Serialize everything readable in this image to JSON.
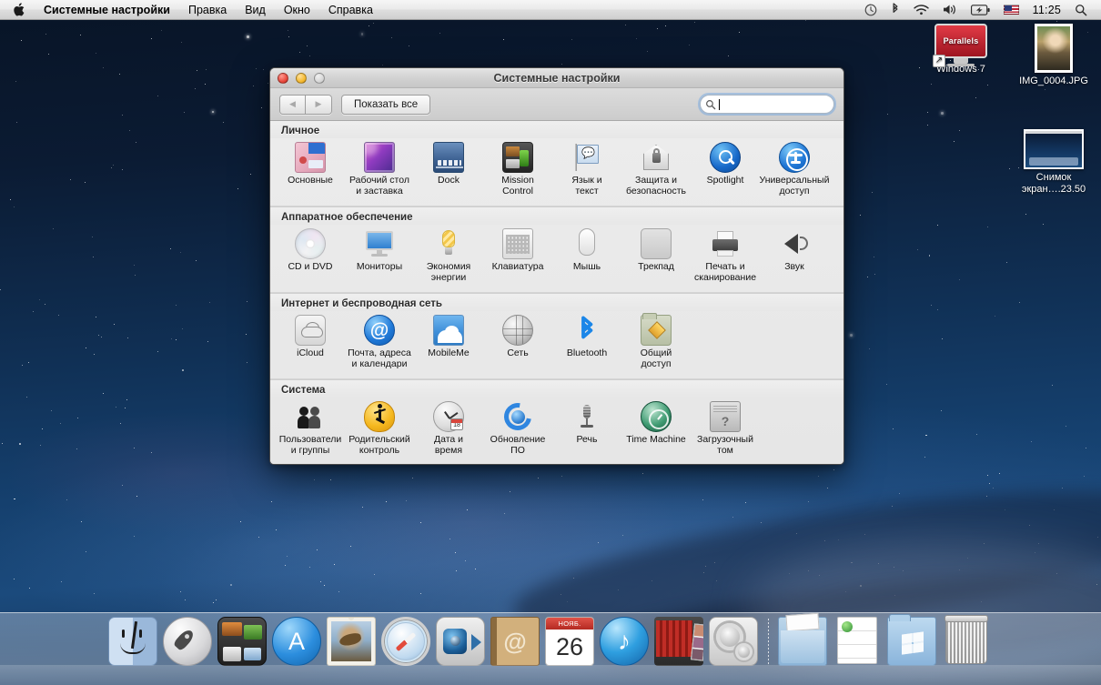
{
  "menubar": {
    "apple_icon": "apple-logo-icon",
    "items": [
      {
        "label": "Системные настройки",
        "bold": true
      },
      {
        "label": "Правка",
        "bold": false
      },
      {
        "label": "Вид",
        "bold": false
      },
      {
        "label": "Окно",
        "bold": false
      },
      {
        "label": "Справка",
        "bold": false
      }
    ],
    "status_icons": [
      {
        "name": "time-machine-icon",
        "glyph": "◔"
      },
      {
        "name": "bluetooth-icon",
        "glyph": "✻"
      },
      {
        "name": "wifi-icon",
        "glyph": "◟"
      },
      {
        "name": "volume-icon",
        "glyph": "◀"
      },
      {
        "name": "battery-icon",
        "glyph": "▭"
      },
      {
        "name": "input-flag-icon",
        "glyph": ""
      }
    ],
    "time": "11:25",
    "spotlight_icon": "search-icon"
  },
  "desktop": {
    "icons": [
      {
        "name": "windows7",
        "label": "Windows 7",
        "type": "parallels-alias",
        "badge": "Parallels"
      },
      {
        "name": "img0004",
        "label": "IMG_0004.JPG",
        "type": "photo"
      },
      {
        "name": "screenshot",
        "label_line1": "Снимок",
        "label_line2": "экран….23.50",
        "type": "screenshot"
      }
    ],
    "partially_hidden_label": "wi"
  },
  "window": {
    "title": "Системные настройки",
    "traffic_lights": [
      "close-button",
      "minimize-button",
      "zoom-button"
    ],
    "toolbar": {
      "back_label": "◀",
      "forward_label": "▶",
      "show_all_label": "Показать все",
      "search_value": "",
      "search_placeholder": ""
    },
    "groups": [
      {
        "title": "Личное",
        "items": [
          {
            "label_line1": "Основные",
            "label_line2": "",
            "icon": "general-icon"
          },
          {
            "label_line1": "Рабочий стол",
            "label_line2": "и заставка",
            "icon": "desktop-screensaver-icon"
          },
          {
            "label_line1": "Dock",
            "label_line2": "",
            "icon": "dock-icon"
          },
          {
            "label_line1": "Mission",
            "label_line2": "Control",
            "icon": "mission-control-icon"
          },
          {
            "label_line1": "Язык и",
            "label_line2": "текст",
            "icon": "language-text-icon"
          },
          {
            "label_line1": "Защита и",
            "label_line2": "безопасность",
            "icon": "security-privacy-icon"
          },
          {
            "label_line1": "Spotlight",
            "label_line2": "",
            "icon": "spotlight-icon"
          },
          {
            "label_line1": "Универсальный",
            "label_line2": "доступ",
            "icon": "universal-access-icon"
          }
        ]
      },
      {
        "title": "Аппаратное обеспечение",
        "items": [
          {
            "label_line1": "CD и DVD",
            "label_line2": "",
            "icon": "cd-dvd-icon"
          },
          {
            "label_line1": "Мониторы",
            "label_line2": "",
            "icon": "displays-icon"
          },
          {
            "label_line1": "Экономия",
            "label_line2": "энергии",
            "icon": "energy-saver-icon"
          },
          {
            "label_line1": "Клавиатура",
            "label_line2": "",
            "icon": "keyboard-icon"
          },
          {
            "label_line1": "Мышь",
            "label_line2": "",
            "icon": "mouse-icon"
          },
          {
            "label_line1": "Трекпад",
            "label_line2": "",
            "icon": "trackpad-icon"
          },
          {
            "label_line1": "Печать и",
            "label_line2": "сканирование",
            "icon": "print-scan-icon"
          },
          {
            "label_line1": "Звук",
            "label_line2": "",
            "icon": "sound-icon"
          }
        ]
      },
      {
        "title": "Интернет и беспроводная сеть",
        "items": [
          {
            "label_line1": "iCloud",
            "label_line2": "",
            "icon": "icloud-icon"
          },
          {
            "label_line1": "Почта, адреса",
            "label_line2": "и календари",
            "icon": "mail-contacts-calendars-icon"
          },
          {
            "label_line1": "MobileMe",
            "label_line2": "",
            "icon": "mobileme-icon"
          },
          {
            "label_line1": "Сеть",
            "label_line2": "",
            "icon": "network-icon"
          },
          {
            "label_line1": "Bluetooth",
            "label_line2": "",
            "icon": "bluetooth-icon"
          },
          {
            "label_line1": "Общий",
            "label_line2": "доступ",
            "icon": "sharing-icon"
          }
        ]
      },
      {
        "title": "Система",
        "items": [
          {
            "label_line1": "Пользователи",
            "label_line2": "и группы",
            "icon": "users-groups-icon"
          },
          {
            "label_line1": "Родительский",
            "label_line2": "контроль",
            "icon": "parental-controls-icon"
          },
          {
            "label_line1": "Дата и",
            "label_line2": "время",
            "icon": "date-time-icon"
          },
          {
            "label_line1": "Обновление",
            "label_line2": "ПО",
            "icon": "software-update-icon"
          },
          {
            "label_line1": "Речь",
            "label_line2": "",
            "icon": "speech-icon"
          },
          {
            "label_line1": "Time Machine",
            "label_line2": "",
            "icon": "time-machine-icon"
          },
          {
            "label_line1": "Загрузочный",
            "label_line2": "том",
            "icon": "startup-disk-icon"
          }
        ]
      }
    ]
  },
  "dock": {
    "items": [
      {
        "name": "finder",
        "icon": "finder-icon"
      },
      {
        "name": "launchpad",
        "icon": "launchpad-icon"
      },
      {
        "name": "mission-control",
        "icon": "mission-control-icon"
      },
      {
        "name": "app-store",
        "icon": "app-store-icon",
        "glyph": "A"
      },
      {
        "name": "mail",
        "icon": "mail-stamp-icon"
      },
      {
        "name": "safari",
        "icon": "safari-compass-icon"
      },
      {
        "name": "facetime",
        "icon": "facetime-camera-icon"
      },
      {
        "name": "address-book",
        "icon": "address-book-icon",
        "glyph": "@"
      },
      {
        "name": "ical",
        "icon": "ical-icon",
        "month": "нояб.",
        "day": "26"
      },
      {
        "name": "itunes",
        "icon": "itunes-icon",
        "glyph": "♪"
      },
      {
        "name": "photo-booth",
        "icon": "photo-booth-icon"
      },
      {
        "name": "system-preferences",
        "icon": "system-preferences-gears-icon"
      },
      {
        "name": "documents-stack",
        "icon": "documents-stack-icon"
      },
      {
        "name": "document-file",
        "icon": "document-icon"
      },
      {
        "name": "windows-folder",
        "icon": "windows-folder-icon"
      },
      {
        "name": "trash",
        "icon": "trash-icon"
      }
    ]
  },
  "colors": {
    "accent_blue": "#1b86e8",
    "window_bg": "#e8e8e8",
    "menubar_bg": "#eaeaea",
    "desktop_deep": "#0b1b33"
  }
}
